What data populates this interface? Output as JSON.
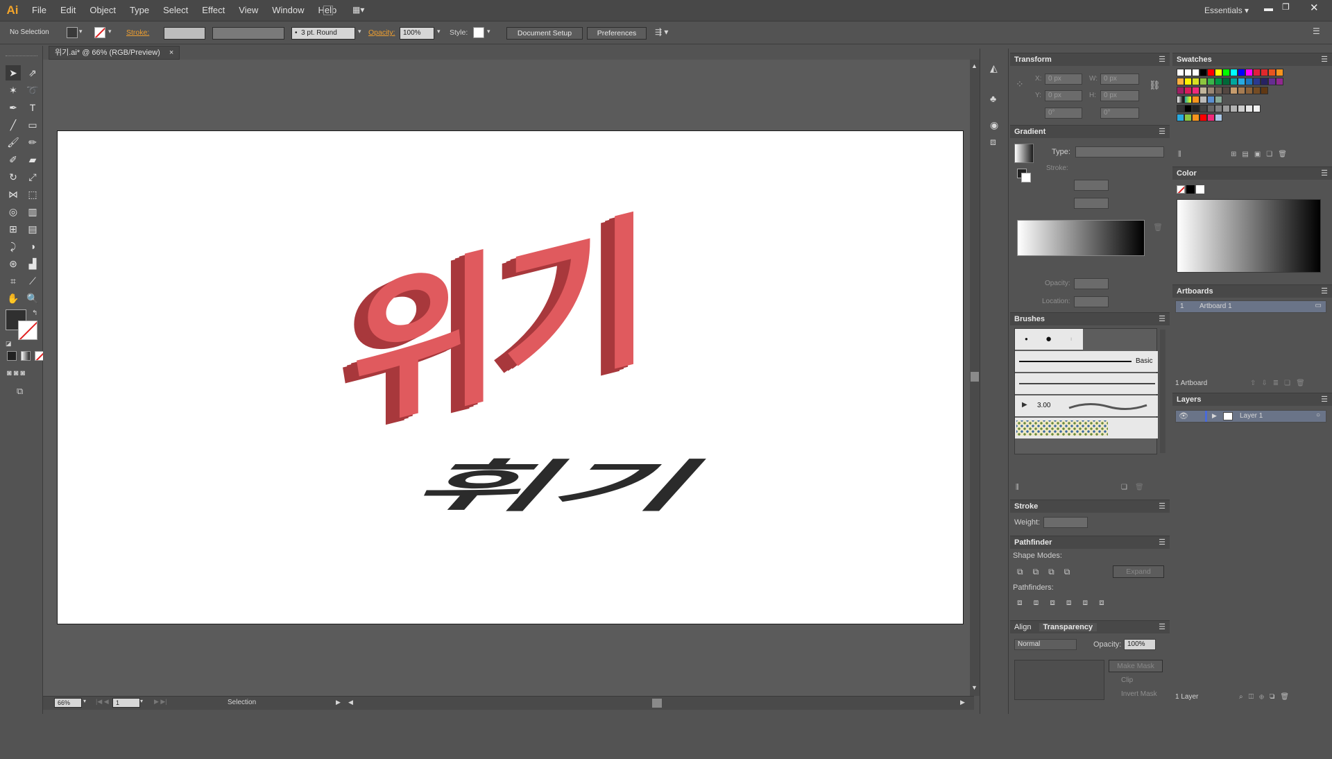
{
  "app": {
    "logo": "Ai",
    "workspace": "Essentials"
  },
  "menu": [
    "File",
    "Edit",
    "Object",
    "Type",
    "Select",
    "Effect",
    "View",
    "Window",
    "Help"
  ],
  "control": {
    "selection": "No Selection",
    "stroke_label": "Stroke:",
    "brush": "3 pt. Round",
    "opacity_label": "Opacity:",
    "opacity": "100%",
    "style_label": "Style:",
    "doc_setup": "Document Setup",
    "preferences": "Preferences"
  },
  "document": {
    "tab_title": "위기.ai* @ 66% (RGB/Preview)"
  },
  "artwork": {
    "top_text": "위기",
    "bottom_text": "휘기",
    "top_color": "#e05a5e",
    "side_color": "#a8383c",
    "shadow_color": "#2b2b2b"
  },
  "status": {
    "zoom": "66%",
    "page": "1",
    "tool": "Selection"
  },
  "transform": {
    "title": "Transform",
    "x_label": "X:",
    "x": "0 px",
    "y_label": "Y:",
    "y": "0 px",
    "w_label": "W:",
    "w": "0 px",
    "h_label": "H:",
    "h": "0 px",
    "rot": "0°",
    "shear": "0°"
  },
  "gradient": {
    "title": "Gradient",
    "type_label": "Type:",
    "stroke_label": "Stroke:",
    "opacity_label": "Opacity:",
    "location_label": "Location:"
  },
  "brushes": {
    "title": "Brushes",
    "basic": "Basic",
    "size": "3.00"
  },
  "stroke": {
    "title": "Stroke",
    "weight_label": "Weight:"
  },
  "pathfinder": {
    "title": "Pathfinder",
    "shape_modes": "Shape Modes:",
    "pathfinders": "Pathfinders:",
    "expand": "Expand"
  },
  "transparency": {
    "tab_align": "Align",
    "tab_transparency": "Transparency",
    "blend": "Normal",
    "opacity_label": "Opacity:",
    "opacity": "100%",
    "make_mask": "Make Mask",
    "clip": "Clip",
    "invert": "Invert Mask"
  },
  "swatches": {
    "title": "Swatches"
  },
  "color": {
    "title": "Color"
  },
  "artboards": {
    "title": "Artboards",
    "items": [
      {
        "index": "1",
        "name": "Artboard 1"
      }
    ],
    "count": "1 Artboard"
  },
  "layers": {
    "title": "Layers",
    "items": [
      {
        "name": "Layer 1"
      }
    ],
    "count": "1 Layer"
  }
}
